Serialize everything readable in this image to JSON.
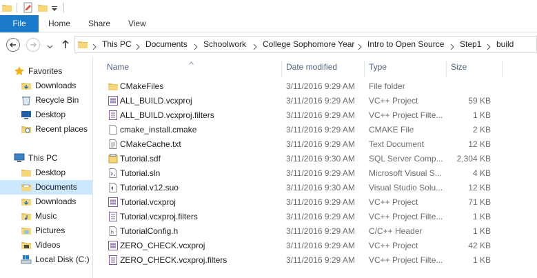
{
  "ribbon": {
    "file_label": "File",
    "tabs": [
      "Home",
      "Share",
      "View"
    ]
  },
  "address": {
    "crumbs": [
      "This PC",
      "Documents",
      "Schoolwork",
      "College Sophomore Year",
      "Intro to Open Source",
      "Step1",
      "build"
    ]
  },
  "nav_pane": {
    "favorites_label": "Favorites",
    "favorites": [
      {
        "label": "Downloads",
        "icon": "downloads-folder-icon"
      },
      {
        "label": "Recycle Bin",
        "icon": "recycle-bin-icon"
      },
      {
        "label": "Desktop",
        "icon": "desktop-icon"
      },
      {
        "label": "Recent places",
        "icon": "recent-places-icon"
      }
    ],
    "thispc_label": "This PC",
    "thispc": [
      {
        "label": "Desktop",
        "icon": "folder-icon"
      },
      {
        "label": "Documents",
        "icon": "documents-icon",
        "selected": true
      },
      {
        "label": "Downloads",
        "icon": "downloads-folder-icon"
      },
      {
        "label": "Music",
        "icon": "music-folder-icon"
      },
      {
        "label": "Pictures",
        "icon": "pictures-folder-icon"
      },
      {
        "label": "Videos",
        "icon": "videos-folder-icon"
      },
      {
        "label": "Local Disk (C:)",
        "icon": "local-disk-icon"
      }
    ]
  },
  "columns": {
    "name": "Name",
    "date": "Date modified",
    "type": "Type",
    "size": "Size"
  },
  "files": [
    {
      "name": "CMakeFiles",
      "date": "3/11/2016 9:29 AM",
      "type": "File folder",
      "size": "",
      "icon": "folder-icon"
    },
    {
      "name": "ALL_BUILD.vcxproj",
      "date": "3/11/2016 9:29 AM",
      "type": "VC++ Project",
      "size": "59 KB",
      "icon": "vcxproj-icon"
    },
    {
      "name": "ALL_BUILD.vcxproj.filters",
      "date": "3/11/2016 9:29 AM",
      "type": "VC++ Project Filte...",
      "size": "1 KB",
      "icon": "filters-icon"
    },
    {
      "name": "cmake_install.cmake",
      "date": "3/11/2016 9:29 AM",
      "type": "CMAKE File",
      "size": "2 KB",
      "icon": "document-icon"
    },
    {
      "name": "CMakeCache.txt",
      "date": "3/11/2016 9:29 AM",
      "type": "Text Document",
      "size": "12 KB",
      "icon": "text-document-icon"
    },
    {
      "name": "Tutorial.sdf",
      "date": "3/11/2016 9:30 AM",
      "type": "SQL Server Comp...",
      "size": "2,304 KB",
      "icon": "sdf-icon"
    },
    {
      "name": "Tutorial.sln",
      "date": "3/11/2016 9:29 AM",
      "type": "Microsoft Visual S...",
      "size": "4 KB",
      "icon": "solution-icon"
    },
    {
      "name": "Tutorial.v12.suo",
      "date": "3/11/2016 9:30 AM",
      "type": "Visual Studio Solu...",
      "size": "12 KB",
      "icon": "suo-icon"
    },
    {
      "name": "Tutorial.vcxproj",
      "date": "3/11/2016 9:29 AM",
      "type": "VC++ Project",
      "size": "71 KB",
      "icon": "vcxproj-icon"
    },
    {
      "name": "Tutorial.vcxproj.filters",
      "date": "3/11/2016 9:29 AM",
      "type": "VC++ Project Filte...",
      "size": "1 KB",
      "icon": "filters-icon"
    },
    {
      "name": "TutorialConfig.h",
      "date": "3/11/2016 9:29 AM",
      "type": "C/C++ Header",
      "size": "1 KB",
      "icon": "header-file-icon"
    },
    {
      "name": "ZERO_CHECK.vcxproj",
      "date": "3/11/2016 9:29 AM",
      "type": "VC++ Project",
      "size": "42 KB",
      "icon": "vcxproj-icon"
    },
    {
      "name": "ZERO_CHECK.vcxproj.filters",
      "date": "3/11/2016 9:29 AM",
      "type": "VC++ Project Filte...",
      "size": "1 KB",
      "icon": "filters-icon"
    }
  ]
}
